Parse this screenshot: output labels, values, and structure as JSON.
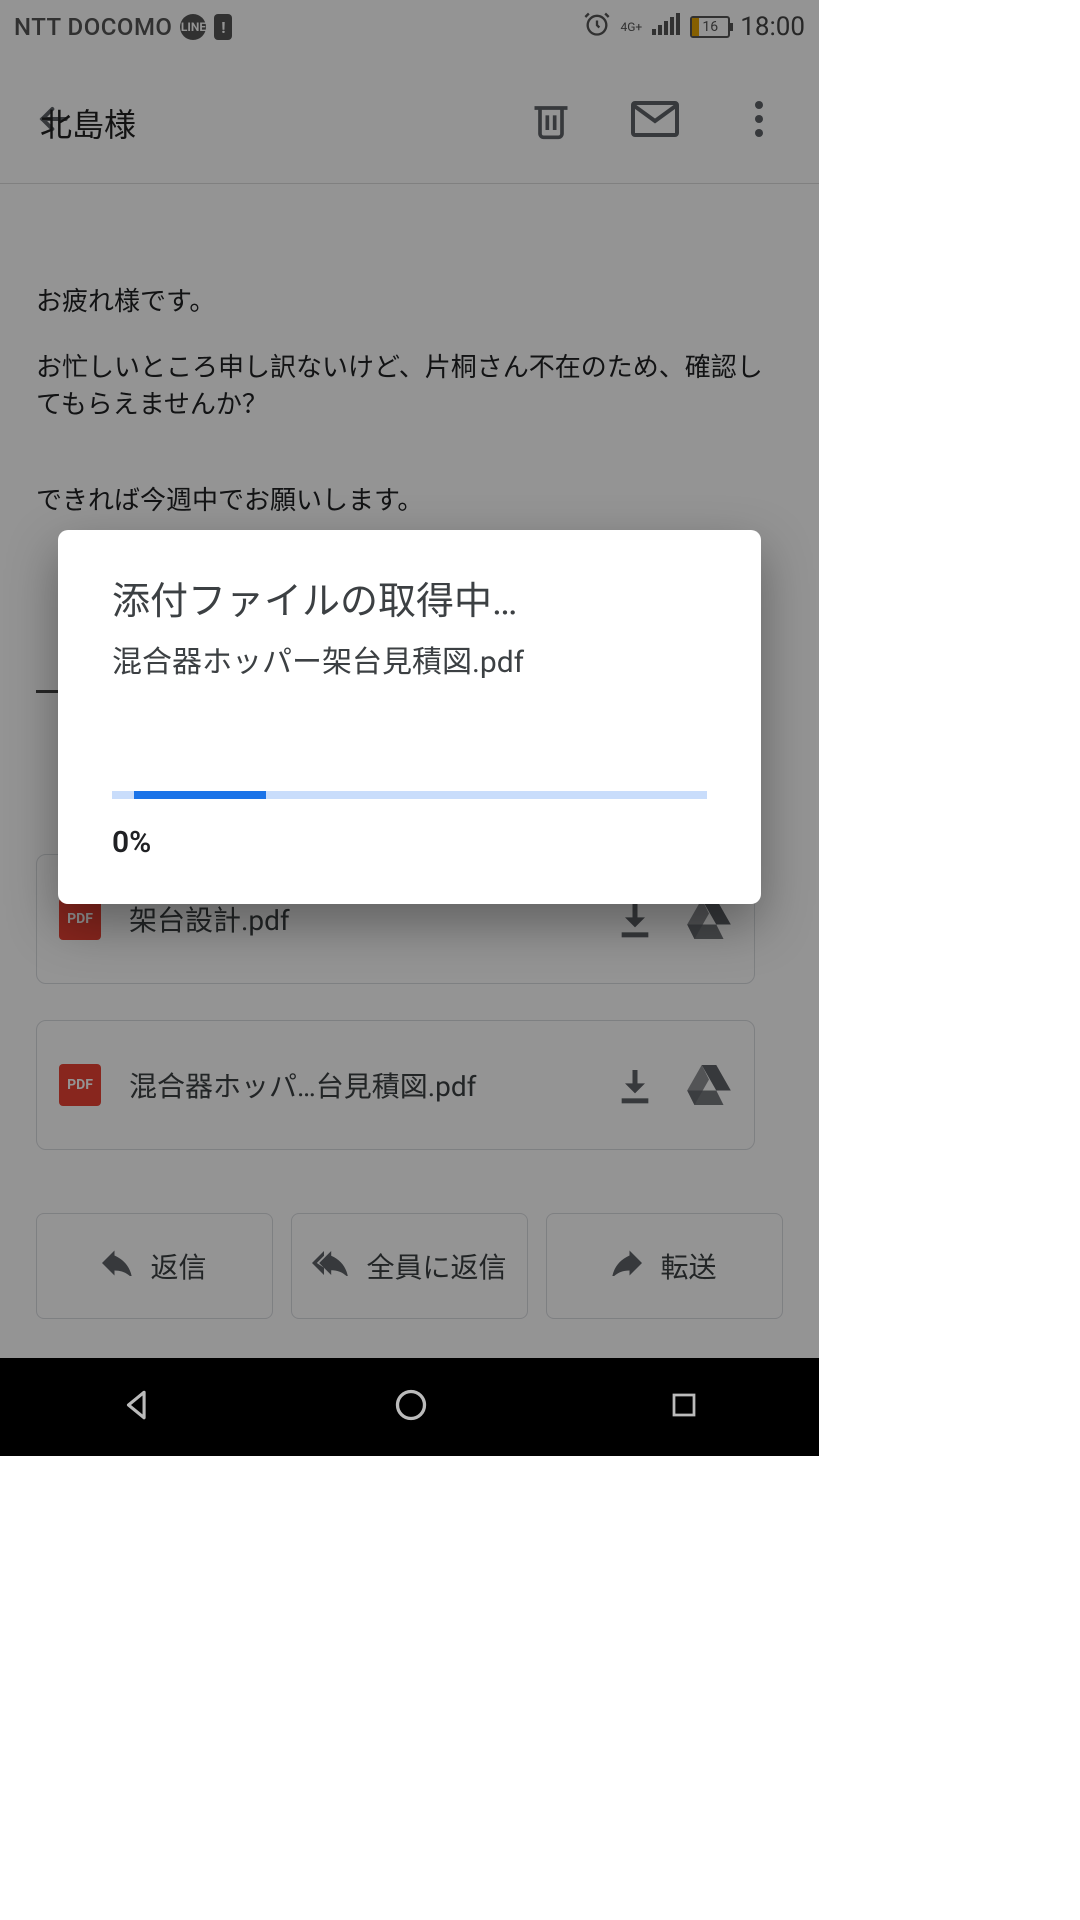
{
  "status": {
    "carrier": "NTT DOCOMO",
    "line_badge": "LINE",
    "network": "4G+",
    "battery_pct": "16",
    "time": "18:00"
  },
  "header": {
    "behind_title": "北島様"
  },
  "email": {
    "p1": "お疲れ様です。",
    "p2": "お忙しいところ申し訳ないけど、片桐さん不在のため、確認してもらえませんか？",
    "p3": "できれば今週中でお願いします。"
  },
  "attachments": [
    {
      "badge": "PDF",
      "name": "架台設計.pdf"
    },
    {
      "badge": "PDF",
      "name": "混合器ホッパ…台見積図.pdf"
    }
  ],
  "actions": {
    "reply": "返信",
    "reply_all": "全員に返信",
    "forward": "転送"
  },
  "dialog": {
    "title": "添付ファイルの取得中…",
    "filename": "混合器ホッパー架台見積図.pdf",
    "percent": "0%"
  }
}
